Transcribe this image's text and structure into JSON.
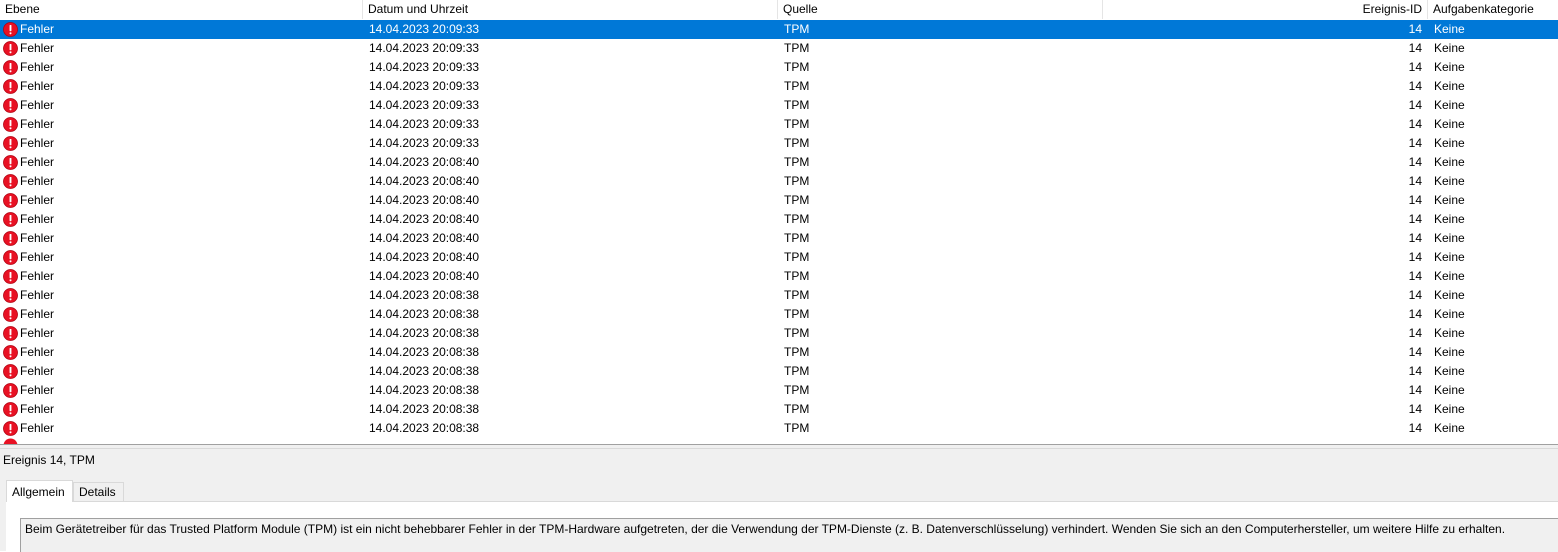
{
  "columns": {
    "level": "Ebene",
    "datetime": "Datum und Uhrzeit",
    "source": "Quelle",
    "event_id": "Ereignis-ID",
    "task_category": "Aufgabenkategorie"
  },
  "icon": "error-icon",
  "colors": {
    "selection": "#0078d7",
    "error": "#e81123"
  },
  "events": [
    {
      "level": "Fehler",
      "datetime": "14.04.2023 20:09:33",
      "source": "TPM",
      "event_id": "14",
      "task_category": "Keine",
      "selected": true
    },
    {
      "level": "Fehler",
      "datetime": "14.04.2023 20:09:33",
      "source": "TPM",
      "event_id": "14",
      "task_category": "Keine"
    },
    {
      "level": "Fehler",
      "datetime": "14.04.2023 20:09:33",
      "source": "TPM",
      "event_id": "14",
      "task_category": "Keine"
    },
    {
      "level": "Fehler",
      "datetime": "14.04.2023 20:09:33",
      "source": "TPM",
      "event_id": "14",
      "task_category": "Keine"
    },
    {
      "level": "Fehler",
      "datetime": "14.04.2023 20:09:33",
      "source": "TPM",
      "event_id": "14",
      "task_category": "Keine"
    },
    {
      "level": "Fehler",
      "datetime": "14.04.2023 20:09:33",
      "source": "TPM",
      "event_id": "14",
      "task_category": "Keine"
    },
    {
      "level": "Fehler",
      "datetime": "14.04.2023 20:09:33",
      "source": "TPM",
      "event_id": "14",
      "task_category": "Keine"
    },
    {
      "level": "Fehler",
      "datetime": "14.04.2023 20:08:40",
      "source": "TPM",
      "event_id": "14",
      "task_category": "Keine"
    },
    {
      "level": "Fehler",
      "datetime": "14.04.2023 20:08:40",
      "source": "TPM",
      "event_id": "14",
      "task_category": "Keine"
    },
    {
      "level": "Fehler",
      "datetime": "14.04.2023 20:08:40",
      "source": "TPM",
      "event_id": "14",
      "task_category": "Keine"
    },
    {
      "level": "Fehler",
      "datetime": "14.04.2023 20:08:40",
      "source": "TPM",
      "event_id": "14",
      "task_category": "Keine"
    },
    {
      "level": "Fehler",
      "datetime": "14.04.2023 20:08:40",
      "source": "TPM",
      "event_id": "14",
      "task_category": "Keine"
    },
    {
      "level": "Fehler",
      "datetime": "14.04.2023 20:08:40",
      "source": "TPM",
      "event_id": "14",
      "task_category": "Keine"
    },
    {
      "level": "Fehler",
      "datetime": "14.04.2023 20:08:40",
      "source": "TPM",
      "event_id": "14",
      "task_category": "Keine"
    },
    {
      "level": "Fehler",
      "datetime": "14.04.2023 20:08:38",
      "source": "TPM",
      "event_id": "14",
      "task_category": "Keine"
    },
    {
      "level": "Fehler",
      "datetime": "14.04.2023 20:08:38",
      "source": "TPM",
      "event_id": "14",
      "task_category": "Keine"
    },
    {
      "level": "Fehler",
      "datetime": "14.04.2023 20:08:38",
      "source": "TPM",
      "event_id": "14",
      "task_category": "Keine"
    },
    {
      "level": "Fehler",
      "datetime": "14.04.2023 20:08:38",
      "source": "TPM",
      "event_id": "14",
      "task_category": "Keine"
    },
    {
      "level": "Fehler",
      "datetime": "14.04.2023 20:08:38",
      "source": "TPM",
      "event_id": "14",
      "task_category": "Keine"
    },
    {
      "level": "Fehler",
      "datetime": "14.04.2023 20:08:38",
      "source": "TPM",
      "event_id": "14",
      "task_category": "Keine"
    },
    {
      "level": "Fehler",
      "datetime": "14.04.2023 20:08:38",
      "source": "TPM",
      "event_id": "14",
      "task_category": "Keine"
    },
    {
      "level": "Fehler",
      "datetime": "14.04.2023 20:08:38",
      "source": "TPM",
      "event_id": "14",
      "task_category": "Keine"
    }
  ],
  "detail": {
    "title": "Ereignis 14, TPM",
    "tabs": [
      "Allgemein",
      "Details"
    ],
    "active_tab": "Allgemein",
    "message": "Beim Gerätetreiber für das Trusted Platform Module (TPM) ist ein nicht behebbarer Fehler in der TPM-Hardware aufgetreten, der die Verwendung der TPM-Dienste (z. B. Datenverschlüsselung) verhindert. Wenden Sie sich an den Computerhersteller, um weitere Hilfe zu erhalten."
  }
}
